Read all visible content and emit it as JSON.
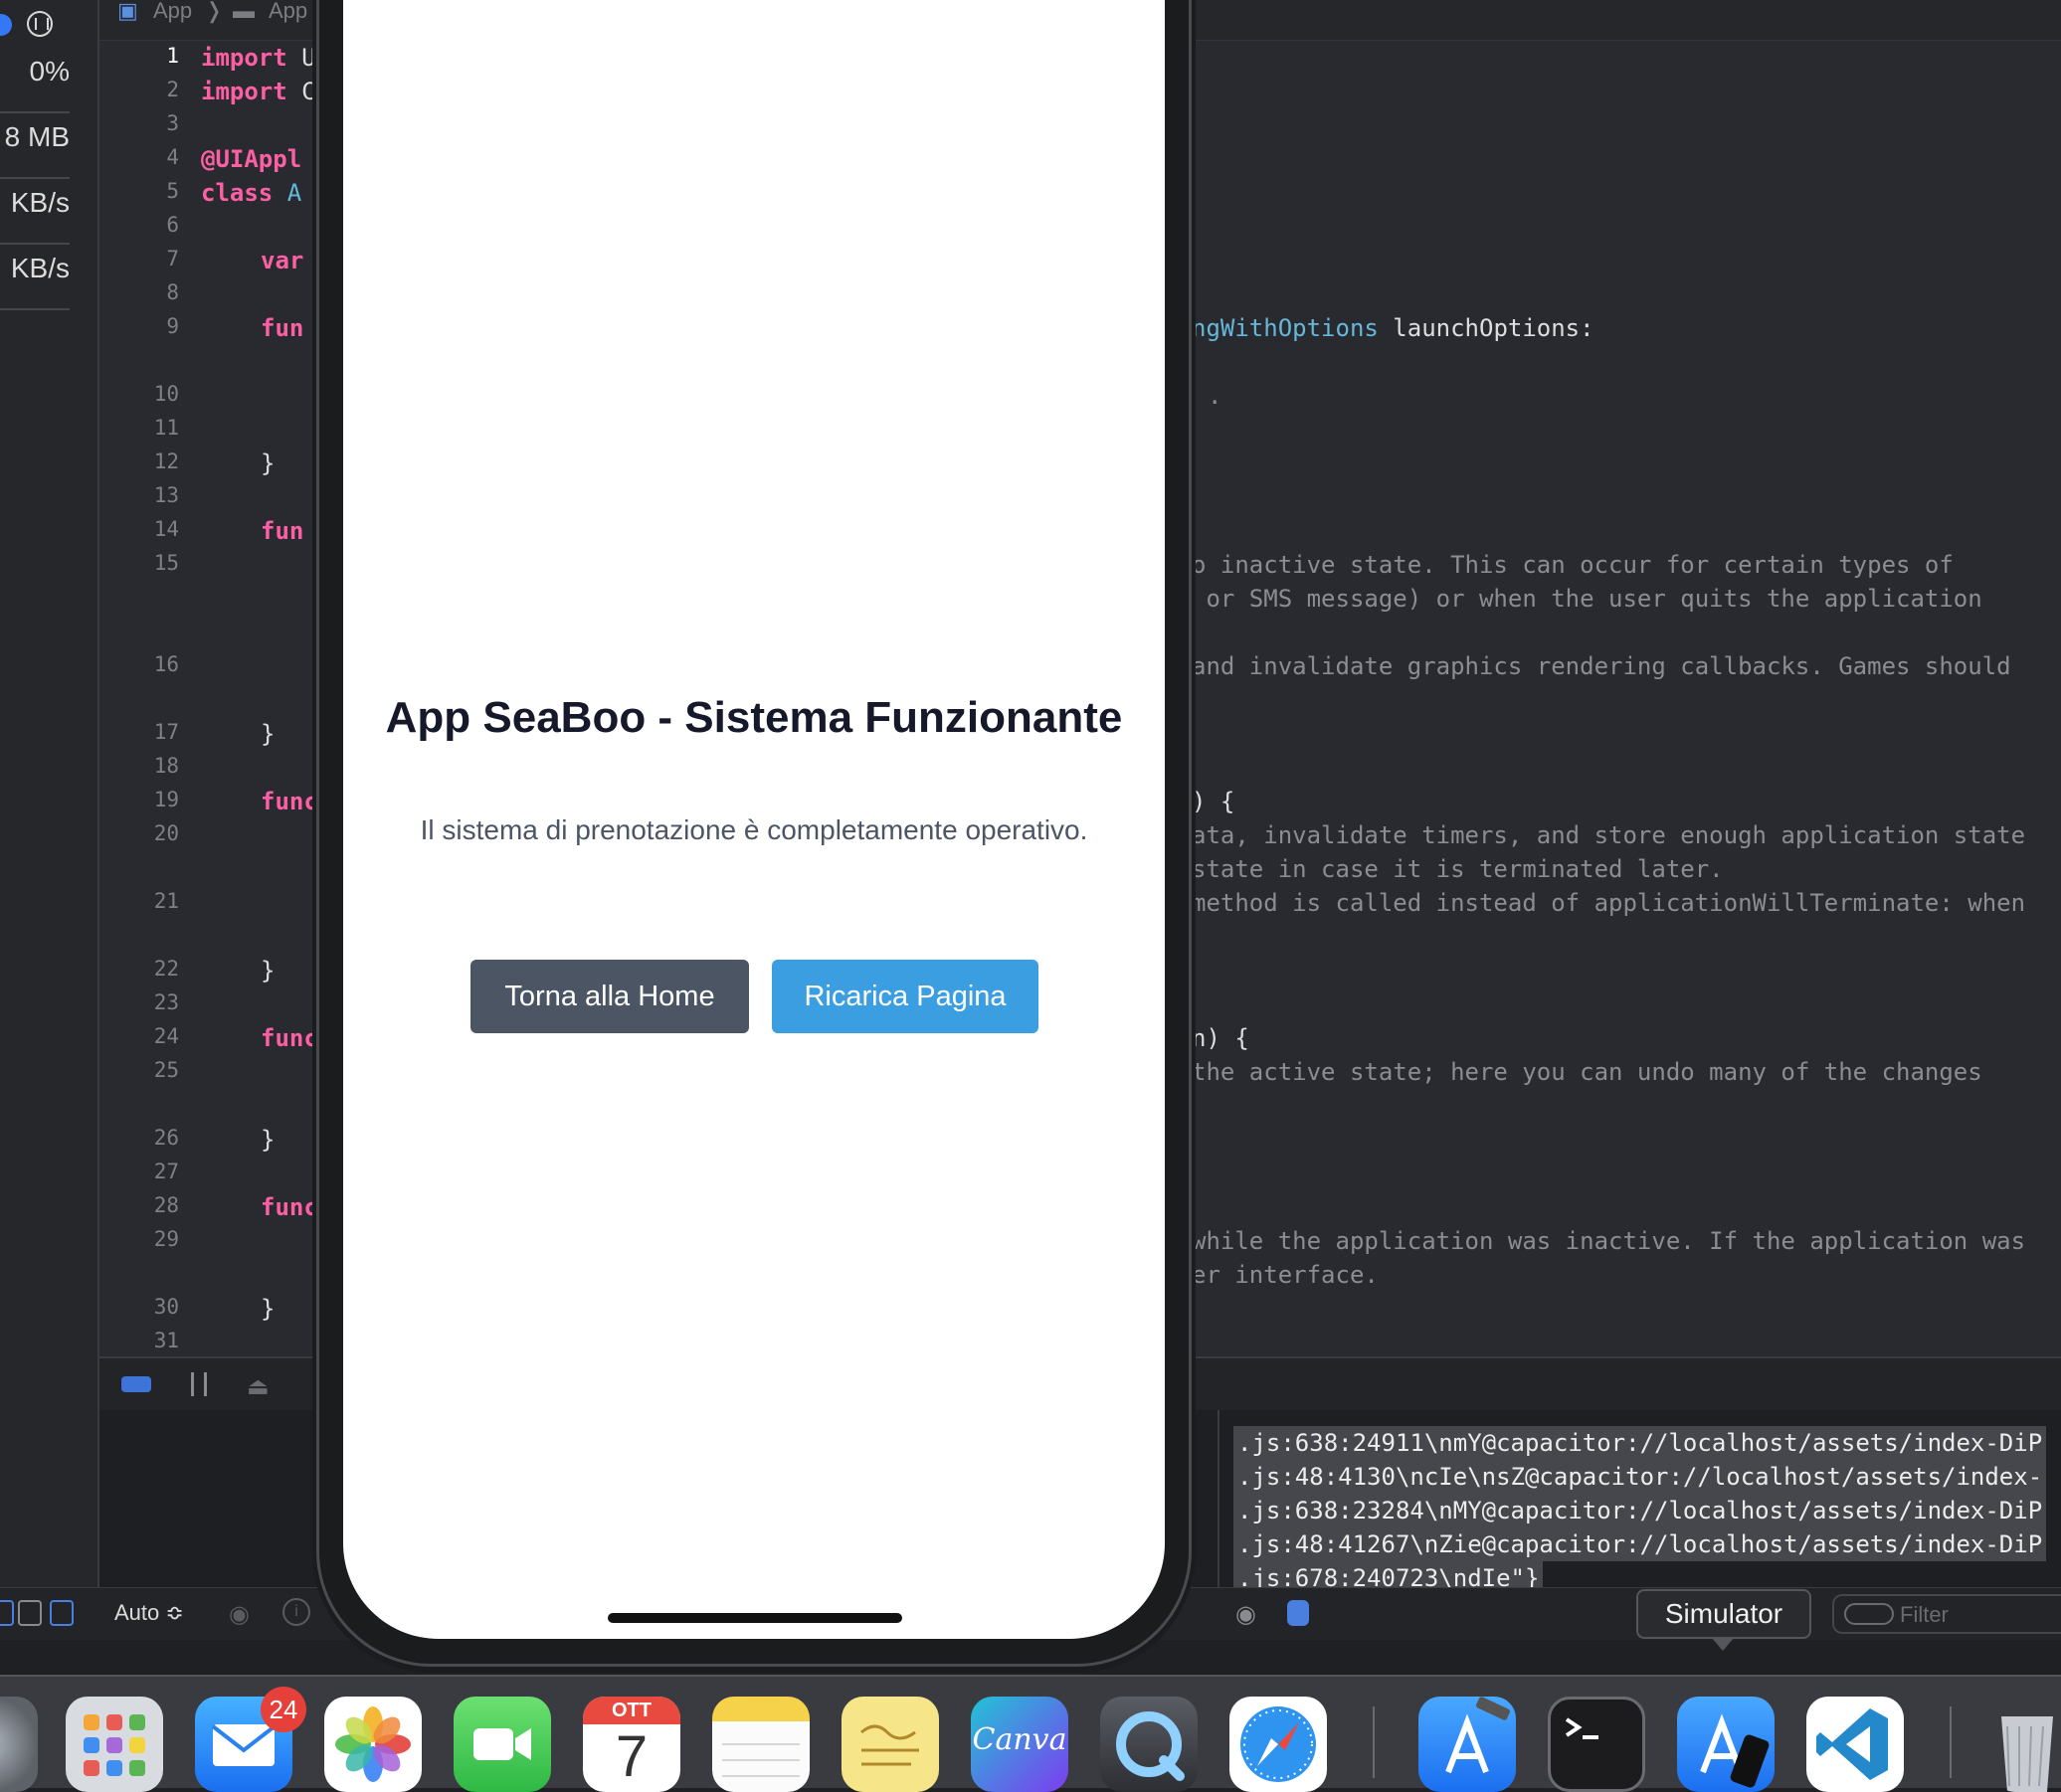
{
  "gauges": {
    "cpu": "0%",
    "memory": "8 MB",
    "net_in": "KB/s",
    "net_out": "KB/s"
  },
  "breadcrumb": {
    "project": "App",
    "separator": "❭",
    "folder": "App"
  },
  "code": {
    "line_numbers": [
      "1",
      "2",
      "3",
      "4",
      "5",
      "6",
      "7",
      "8",
      "9",
      "10",
      "11",
      "12",
      "13",
      "14",
      "15",
      "16",
      "17",
      "18",
      "19",
      "20",
      "21",
      "22",
      "23",
      "24",
      "25",
      "26",
      "27",
      "28",
      "29",
      "30",
      "31"
    ],
    "left_fragments": {
      "l1_kw": "import",
      "l1_rest": " U",
      "l2_kw": "import",
      "l2_rest": " C",
      "l4_attr": "@UIAppl",
      "l5_kw": "class",
      "l5_rest": " A",
      "l7_kw": "var",
      "l9_kw": "fun",
      "l12": "}",
      "l14_kw": "fun",
      "l17": "}",
      "l19_kw": "func",
      "l22": "}",
      "l24_kw": "func",
      "l26": "}",
      "l28_kw": "func",
      "l30": "}"
    },
    "right_fragments": {
      "r9_fn": "ngWithOptions",
      "r9_rest": " launchOptions:",
      "r10": ".",
      "r15a": "o inactive state. This can occur for certain types of",
      "r15b": " or SMS message) or when the user quits the application",
      "r16": "and invalidate graphics rendering callbacks. Games should",
      "r19": ") {",
      "r20a": "ata, invalidate timers, and store enough application state",
      "r20b": "state in case it is terminated later.",
      "r21": "method is called instead of applicationWillTerminate: when",
      "r24": "n) {",
      "r25": "the active state; here you can undo many of the changes",
      "r29a": "while the application was inactive. If the application was",
      "r29b": "er interface."
    }
  },
  "console": {
    "lines": [
      ".js:638:24911\\nmY@capacitor://localhost/assets/index-DiP",
      ".js:48:4130\\ncIe\\nsZ@capacitor://localhost/assets/index-",
      ".js:638:23284\\nMY@capacitor://localhost/assets/index-DiP",
      ".js:48:41267\\nZie@capacitor://localhost/assets/index-DiP",
      ".js:678:240723\\ndIe\"}"
    ]
  },
  "statusbar": {
    "auto_label": "Auto ≎",
    "filter_placeholder": "Filter",
    "tooltip": "Simulator"
  },
  "app": {
    "title": "App SeaBoo - Sistema Funzionante",
    "message": "Il sistema di prenotazione è completamente operativo.",
    "home_button": "Torna alla Home",
    "reload_button": "Ricarica Pagina"
  },
  "dock": {
    "mail_badge": "24",
    "calendar_month": "OTT",
    "calendar_day": "7",
    "canva_label": "Canva",
    "apps": [
      "System Settings",
      "Launchpad",
      "Mail",
      "Photos",
      "FaceTime",
      "Calendar",
      "Notes",
      "Stickies",
      "Canva",
      "QuickTime Player",
      "Safari",
      "Xcode",
      "Terminal",
      "Simulator",
      "Visual Studio Code",
      "Trash"
    ]
  },
  "colors": {
    "home_button_bg": "#4b5563",
    "reload_button_bg": "#3b9ee0",
    "keyword": "#fc5fa3",
    "editor_bg": "#292a30"
  }
}
